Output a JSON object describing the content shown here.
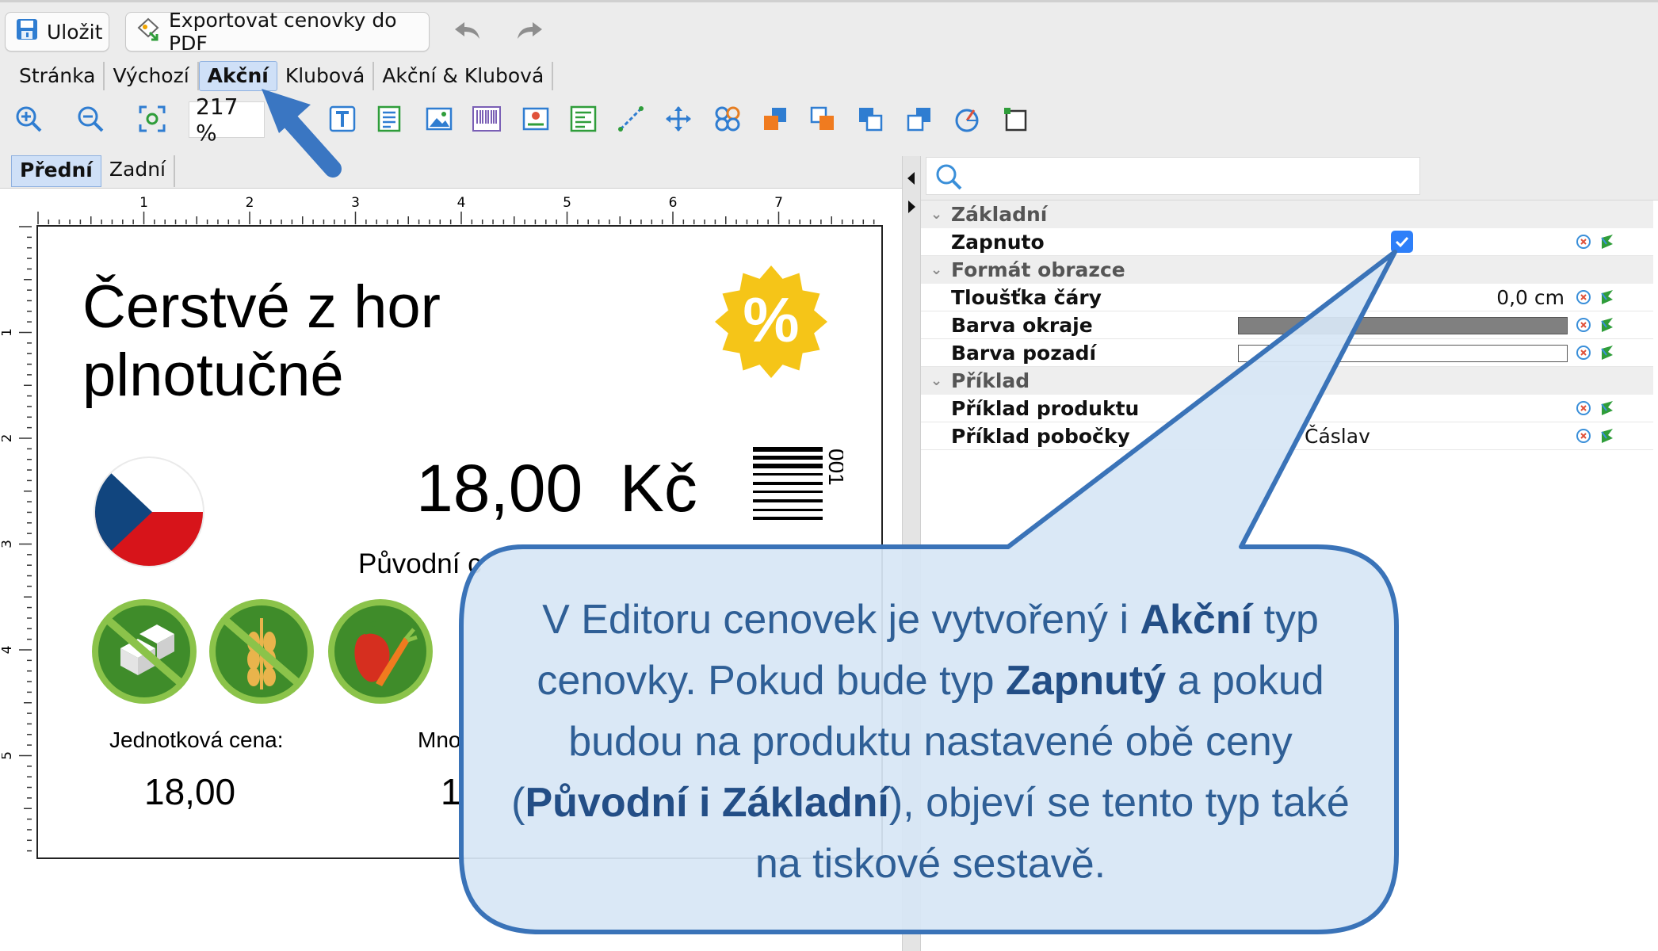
{
  "toolbar": {
    "save_label": "Uložit",
    "export_label": "Exportovat cenovky do PDF"
  },
  "mode_tabs": [
    "Stránka",
    "Výchozí",
    "Akční",
    "Klubová",
    "Akční & Klubová"
  ],
  "active_mode_tab": "Akční",
  "zoom": "217 %",
  "side_tabs": [
    "Přední",
    "Zadní"
  ],
  "ruler": {
    "h_ticks": [
      "1",
      "2",
      "3",
      "4",
      "5",
      "6",
      "7"
    ],
    "v_ticks": [
      "1",
      "2",
      "3",
      "4",
      "5"
    ]
  },
  "label": {
    "title_line1": "Čerstvé z hor",
    "title_line2": "plnotučné",
    "price": "18,00",
    "currency": "Kč",
    "original_label": "Původní c",
    "unit_price_label": "Jednotková cena:",
    "unit_price_value": "18,00",
    "quantity_label": "Mno",
    "quantity_value": "1",
    "badge_symbol": "%",
    "barcode_digits": "001",
    "colors": {
      "badge": "#f5c518",
      "allergen_green": "#4c9a2a",
      "flag_blue": "#11457e",
      "flag_red": "#d7141a"
    }
  },
  "properties": {
    "groups": [
      {
        "name": "Základní",
        "items": [
          {
            "name": "Zapnuto",
            "type": "checkbox",
            "checked": true
          }
        ]
      },
      {
        "name": "Formát obrazce",
        "items": [
          {
            "name": "Tloušťka čáry",
            "type": "text",
            "value": "0,0 cm"
          },
          {
            "name": "Barva okraje",
            "type": "color",
            "value": "#808080"
          },
          {
            "name": "Barva pozadí",
            "type": "color",
            "value": "#ffffff"
          }
        ]
      },
      {
        "name": "Příklad",
        "items": [
          {
            "name": "Příklad produktu",
            "type": "text",
            "value": ""
          },
          {
            "name": "Příklad pobočky",
            "type": "text",
            "value": "Čáslav"
          }
        ]
      }
    ]
  },
  "callout": {
    "segments": [
      {
        "text": "V Editoru cenovek je vytvořený i ",
        "bold": false
      },
      {
        "text": "Akční",
        "bold": true
      },
      {
        "text": " typ cenovky. Pokud bude typ ",
        "bold": false
      },
      {
        "text": "Zapnutý",
        "bold": true
      },
      {
        "text": " a pokud budou na produktu nastavené obě ceny (",
        "bold": false
      },
      {
        "text": "Původní i Základní",
        "bold": true
      },
      {
        "text": "), objeví se tento typ také na tiskové sestavě.",
        "bold": false
      }
    ],
    "color": "#2f5f96",
    "border_color": "#3a73b8"
  },
  "accent_arrow_color": "#3a76c2"
}
